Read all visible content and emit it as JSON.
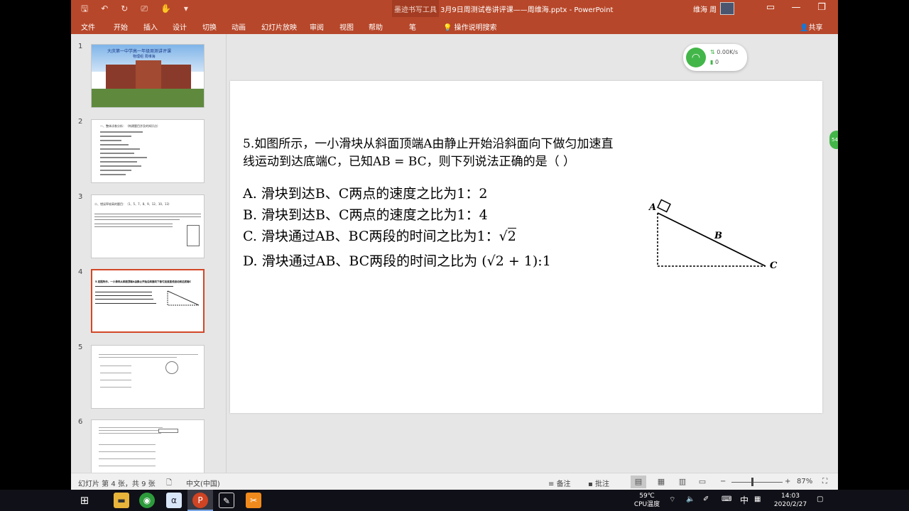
{
  "window": {
    "context_tab_title": "墨迹书写工具",
    "doc_title": "3月9日周测试卷讲评课——周维海.pptx  -  PowerPoint",
    "user": "维海 周",
    "controls": {
      "restore": "▭",
      "minimize": "—",
      "maximize": "❐",
      "close": "✕"
    },
    "qat": {
      "save": "🖫",
      "undo": "↶",
      "redo": "↻",
      "present": "⎚",
      "touch": "✋",
      "more": "▾"
    }
  },
  "ribbon": {
    "tabs": [
      "文件",
      "开始",
      "插入",
      "设计",
      "切换",
      "动画",
      "幻灯片放映",
      "审阅",
      "视图",
      "帮助",
      "笔"
    ],
    "tell_me": "操作说明搜索",
    "share": "共享"
  },
  "thumbnails": [
    {
      "num": "1",
      "title": "大庆第一中学高一年级周测讲评课",
      "subtitle": "物理组  周维海"
    },
    {
      "num": "2",
      "heading": "一、整体试卷分析：（构建题目涉及的知识点）"
    },
    {
      "num": "3",
      "heading": "二、错误率较高的题目：（1、5、7、8、9、12、10、13）"
    },
    {
      "num": "4",
      "heading": "5.如图所示，一小滑块从斜面顶端A由静止开始沿斜面向下做匀加速直线运动到达底端C"
    },
    {
      "num": "5",
      "heading": ""
    },
    {
      "num": "6",
      "heading": ""
    }
  ],
  "slide": {
    "question_line1": "5.如图所示，一小滑块从斜面顶端A由静止开始沿斜面向下做匀加速直",
    "question_line2": "线运动到达底端C，已知AB = BC，则下列说法正确的是（     ）",
    "options": [
      "A. 滑块到达B、C两点的速度之比为1：2",
      "B. 滑块到达B、C两点的速度之比为1：4",
      "C. 滑块通过AB、BC两段的时间之比为1：",
      "D. 滑块通过AB、BC两段的时间之比为"
    ],
    "sqrt_c": "2",
    "formula_d": "(√2 + 1):1",
    "diagram_labels": {
      "a": "A",
      "b": "B",
      "c": "C"
    }
  },
  "network_widget": {
    "speed": "0.00K/s",
    "count": "0",
    "side_label": "54"
  },
  "statusbar": {
    "slide_info": "幻灯片 第 4 张，共 9 张",
    "language": "中文(中国)",
    "notes": "备注",
    "comments": "批注",
    "zoom": "87%",
    "zoom_minus": "−",
    "zoom_plus": "+"
  },
  "taskbar": {
    "temp": "59℃",
    "temp_label": "CPU温度",
    "ime": "中",
    "time": "14:03",
    "date": "2020/2/27",
    "apps": [
      "windows-start",
      "file-explorer",
      "browser",
      "geometry-app",
      "powerpoint",
      "ink-app",
      "tool-app"
    ]
  },
  "colors": {
    "accent": "#b7472a",
    "selected_border": "#d24726",
    "net_green": "#43b649"
  }
}
